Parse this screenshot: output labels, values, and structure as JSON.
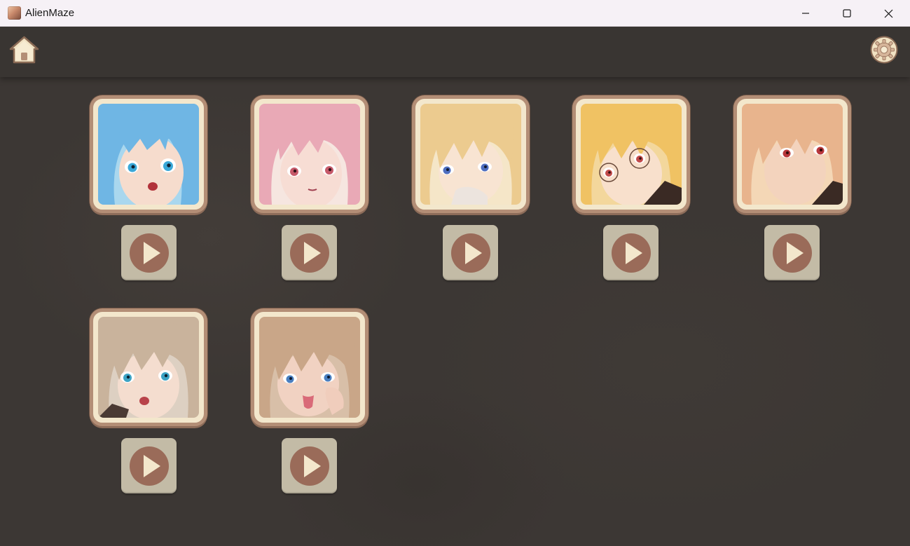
{
  "window": {
    "title": "AlienMaze",
    "controls": {
      "minimize_icon": "minimize-icon",
      "maximize_icon": "maximize-icon",
      "close_icon": "close-icon"
    }
  },
  "toolbar": {
    "home_icon": "home-icon",
    "settings_icon": "gear-icon"
  },
  "colors": {
    "background": "#3c3734",
    "topbar": "#393532",
    "frame_border": "#b38e76",
    "frame_fill": "#f3e7cc",
    "play_button": "#c3bba6",
    "play_circle": "#9a6b59",
    "play_triangle": "#f3e7cc"
  },
  "characters": [
    {
      "portrait": "blue-haired-girl-portrait",
      "hair": "#6fb6e4",
      "skin": "#f6dccd",
      "eyes": "#3aa8d8",
      "play_icon": "play-icon"
    },
    {
      "portrait": "pink-haired-girl-portrait",
      "hair": "#e9a9b6",
      "skin": "#f7ddd4",
      "eyes": "#c65a6a",
      "play_icon": "play-icon"
    },
    {
      "portrait": "blonde-girl-portrait",
      "hair": "#eccb8f",
      "skin": "#f8e4d2",
      "eyes": "#4f6fc0",
      "play_icon": "play-icon"
    },
    {
      "portrait": "blonde-glasses-girl-portrait",
      "hair": "#f0c263",
      "skin": "#f8e0cc",
      "eyes": "#c24a4a",
      "play_icon": "play-icon"
    },
    {
      "portrait": "strawberry-blonde-girl-portrait",
      "hair": "#e8b48d",
      "skin": "#f3d3bd",
      "eyes": "#b8383c",
      "play_icon": "play-icon"
    },
    {
      "portrait": "ash-blonde-girl-portrait",
      "hair": "#c9b39c",
      "skin": "#f4ddcf",
      "eyes": "#3ca3c4",
      "play_icon": "play-icon"
    },
    {
      "portrait": "light-brown-haired-girl-portrait",
      "hair": "#c9a688",
      "skin": "#f1d2c2",
      "eyes": "#4a7fc0",
      "play_icon": "play-icon"
    }
  ]
}
